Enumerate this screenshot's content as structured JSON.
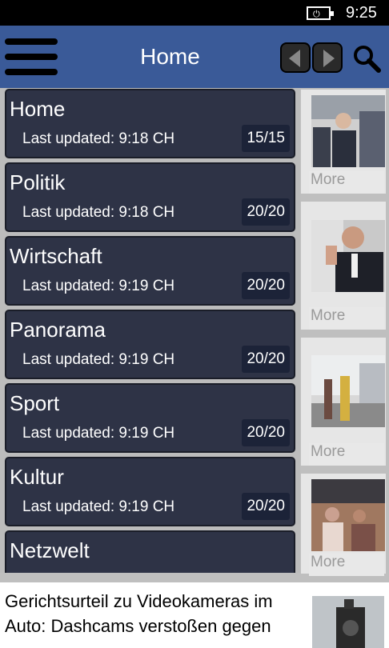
{
  "status_bar": {
    "time": "9:25",
    "battery_icon": "battery-charging-icon"
  },
  "app_bar": {
    "title": "Home",
    "menu_icon": "hamburger-icon",
    "prev_icon": "arrow-left-icon",
    "next_icon": "arrow-right-icon",
    "search_icon": "search-icon",
    "accent": "#3a5a98"
  },
  "menu": {
    "items": [
      {
        "title": "Home",
        "updated": "Last updated: 9:18 CH",
        "count": "15/15"
      },
      {
        "title": "Politik",
        "updated": "Last updated: 9:18 CH",
        "count": "20/20"
      },
      {
        "title": "Wirtschaft",
        "updated": "Last updated: 9:19 CH",
        "count": "20/20"
      },
      {
        "title": "Panorama",
        "updated": "Last updated: 9:19 CH",
        "count": "20/20"
      },
      {
        "title": "Sport",
        "updated": "Last updated: 9:19 CH",
        "count": "20/20"
      },
      {
        "title": "Kultur",
        "updated": "Last updated: 9:19 CH",
        "count": "20/20"
      },
      {
        "title": "Netzwelt",
        "updated": "",
        "count": ""
      }
    ]
  },
  "articles": {
    "more_label": "More",
    "bottom_title": "Gerichtsurteil zu Videokameras im Auto: Dashcams verstoßen gegen"
  }
}
